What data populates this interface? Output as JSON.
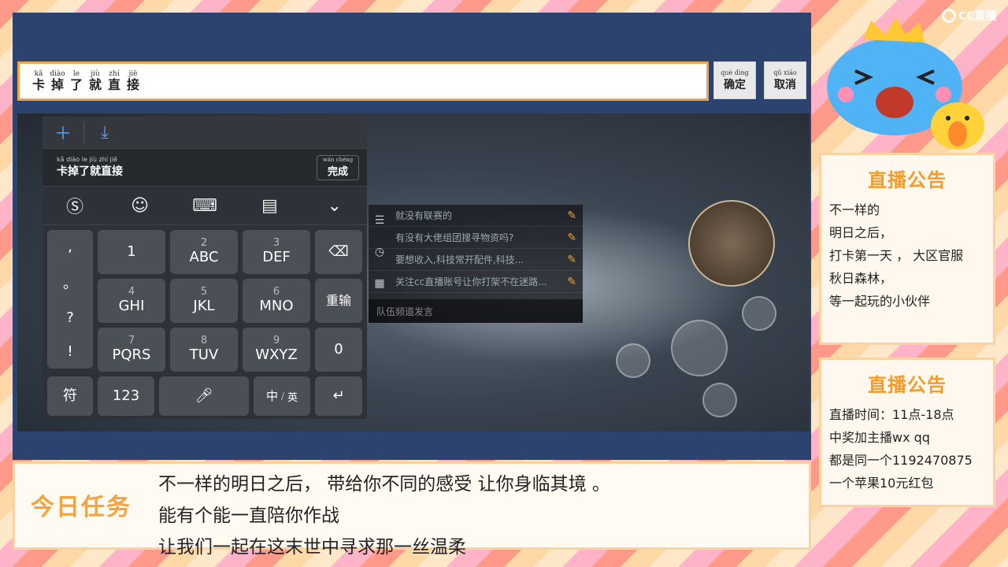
{
  "input_bar": {
    "chars": [
      {
        "py": "kǎ",
        "hz": "卡"
      },
      {
        "py": "diào",
        "hz": "掉"
      },
      {
        "py": "le",
        "hz": "了"
      },
      {
        "py": "jiù",
        "hz": "就"
      },
      {
        "py": "zhí",
        "hz": "直"
      },
      {
        "py": "jiē",
        "hz": "接"
      }
    ],
    "confirm": {
      "py": "què dìng",
      "hz": "确定"
    },
    "cancel": {
      "py": "qǔ xiāo",
      "hz": "取消"
    }
  },
  "keyboard": {
    "candidate": "卡掉了就直接",
    "candidate_py": "kǎ diào le jiù zhí jiē",
    "done": {
      "py": "wán chéng",
      "hz": "完成"
    },
    "punct": [
      ",",
      "。",
      "?",
      "!"
    ],
    "keys": [
      {
        "num": "",
        "lbl": "1"
      },
      {
        "num": "2",
        "lbl": "ABC"
      },
      {
        "num": "3",
        "lbl": "DEF"
      },
      {
        "num": "4",
        "lbl": "GHI"
      },
      {
        "num": "5",
        "lbl": "JKL"
      },
      {
        "num": "6",
        "lbl": "MNO"
      },
      {
        "num": "7",
        "lbl": "PQRS"
      },
      {
        "num": "8",
        "lbl": "TUV"
      },
      {
        "num": "9",
        "lbl": "WXYZ"
      }
    ],
    "backspace_icon": "backspace-icon",
    "reinput": "重输",
    "zero": "0",
    "symbol": "符",
    "num123": "123",
    "lang_cn": "中",
    "lang_en": "英"
  },
  "chat": {
    "rows": [
      "就没有联赛的",
      "有没有大佬组团搜寻物资吗?",
      "要想收入,科技常开配件,科技...",
      "关注cc直播账号让你打架不在迷路..."
    ],
    "send_placeholder": "队伍频道发言"
  },
  "caption": {
    "task_title": "今日任务",
    "lines": [
      "不一样的明日之后， 带给你不同的感受  让你身临其境 。",
      "能有个能一直陪你作战",
      "让我们一起在这末世中寻求那一丝温柔"
    ]
  },
  "notice1": {
    "title": "直播公告",
    "lines": [
      "不一样的",
      "明日之后，",
      "打卡第一天 ， 大区官服",
      "秋日森林，",
      "等一起玩的小伙伴"
    ]
  },
  "notice2": {
    "title": "直播公告",
    "lines": [
      "直播时间：11点-18点",
      "中奖加主播wx qq",
      "都是同一个1192470875",
      "一个苹果10元红包"
    ]
  },
  "logo": {
    "text": "CC直播"
  },
  "colors": {
    "accent": "#f39c2b",
    "stream_bg": "#2c4370",
    "keyboard_bg": "#2e3137"
  }
}
